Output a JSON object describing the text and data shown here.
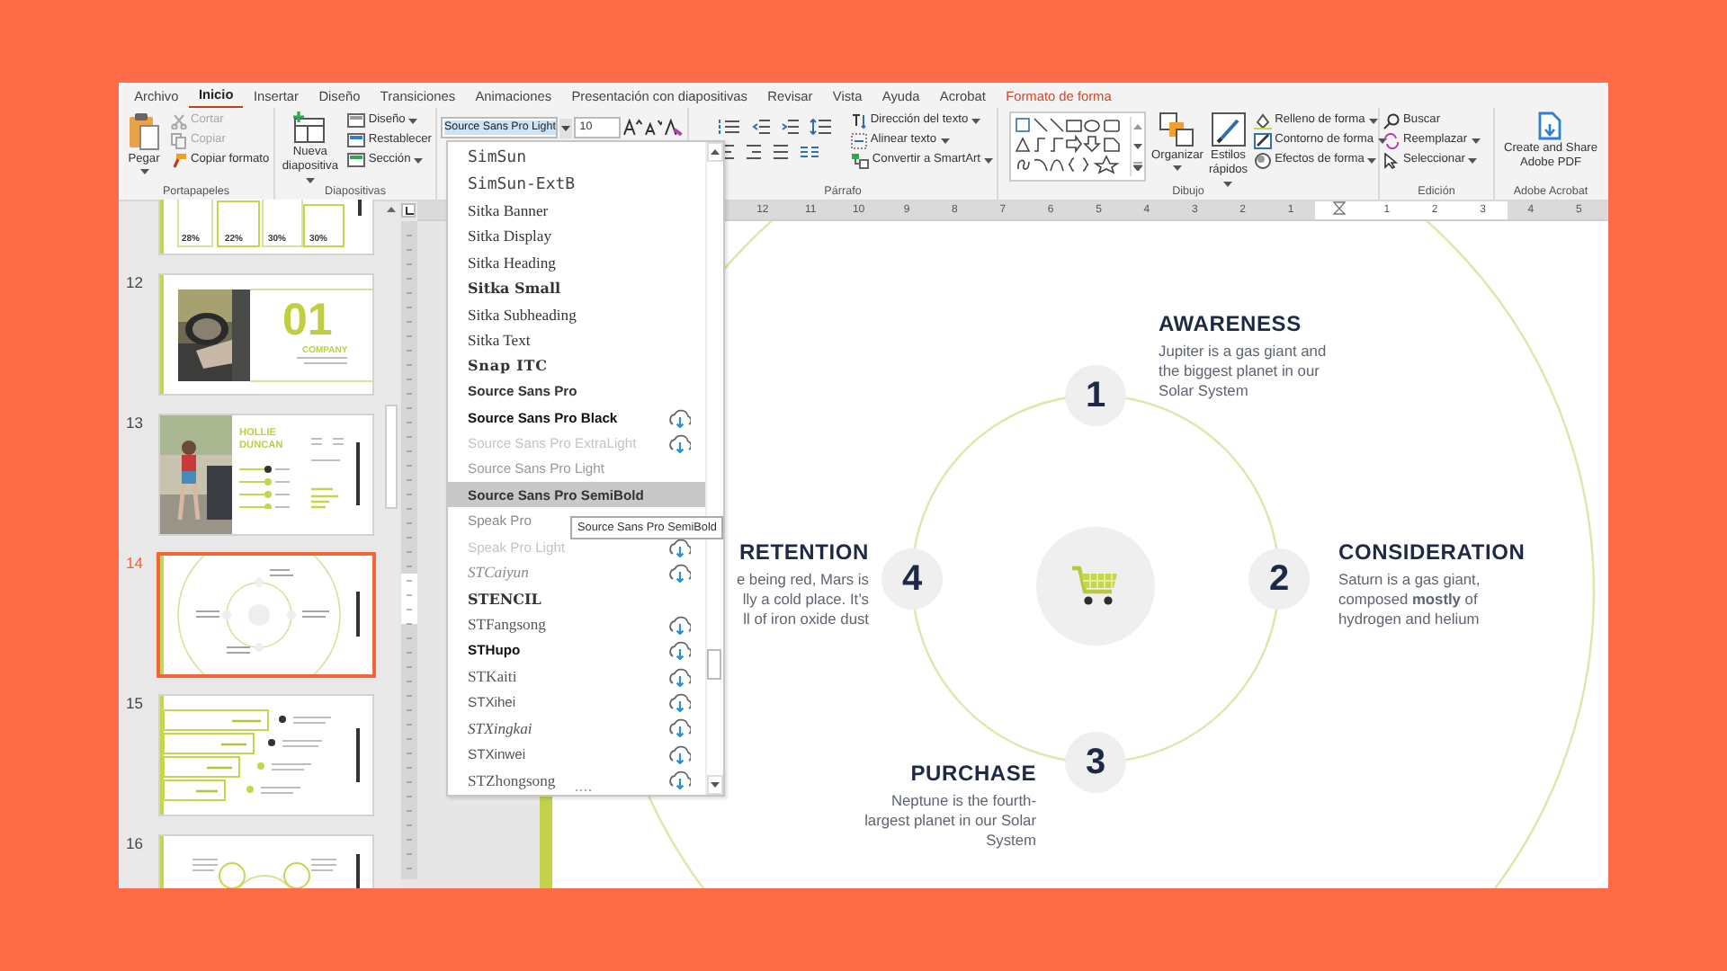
{
  "tabs": [
    {
      "label": "Archivo",
      "selected": false,
      "contextual": false
    },
    {
      "label": "Inicio",
      "selected": true,
      "contextual": false
    },
    {
      "label": "Insertar",
      "selected": false,
      "contextual": false
    },
    {
      "label": "Diseño",
      "selected": false,
      "contextual": false
    },
    {
      "label": "Transiciones",
      "selected": false,
      "contextual": false
    },
    {
      "label": "Animaciones",
      "selected": false,
      "contextual": false
    },
    {
      "label": "Presentación con diapositivas",
      "selected": false,
      "contextual": false
    },
    {
      "label": "Revisar",
      "selected": false,
      "contextual": false
    },
    {
      "label": "Vista",
      "selected": false,
      "contextual": false
    },
    {
      "label": "Ayuda",
      "selected": false,
      "contextual": false
    },
    {
      "label": "Acrobat",
      "selected": false,
      "contextual": false
    },
    {
      "label": "Formato de forma",
      "selected": false,
      "contextual": true
    }
  ],
  "ribbon": {
    "clipboard": {
      "title": "Portapapeles",
      "paste": "Pegar",
      "items": [
        {
          "label": "Cortar",
          "disabled": true
        },
        {
          "label": "Copiar",
          "disabled": true
        },
        {
          "label": "Copiar formato",
          "disabled": false
        }
      ]
    },
    "slides_group": {
      "title": "Diapositivas",
      "new_slide": "Nueva diapositiva",
      "items": [
        "Diseño",
        "Restablecer",
        "Sección"
      ]
    },
    "font": {
      "name": "Source Sans Pro Light",
      "size": "10"
    },
    "paragraph": {
      "title": "Párrafo",
      "items": [
        "Dirección del texto",
        "Alinear texto",
        "Convertir a SmartArt"
      ]
    },
    "drawing": {
      "title": "Dibujo",
      "arrange": "Organizar",
      "quick_styles": "Estilos rápidos",
      "items": [
        "Relleno de forma",
        "Contorno de forma",
        "Efectos de forma"
      ]
    },
    "editing": {
      "title": "Edición",
      "items": [
        "Buscar",
        "Reemplazar",
        "Seleccionar"
      ]
    },
    "acrobat": {
      "title": "Adobe Acrobat",
      "button": "Create and Share Adobe PDF"
    }
  },
  "font_list": {
    "items": [
      {
        "name": "SimSun",
        "cloud": false,
        "selected": false
      },
      {
        "name": "SimSun-ExtB",
        "cloud": false,
        "selected": false
      },
      {
        "name": "Sitka Banner",
        "cloud": false,
        "selected": false
      },
      {
        "name": "Sitka Display",
        "cloud": false,
        "selected": false
      },
      {
        "name": "Sitka Heading",
        "cloud": false,
        "selected": false
      },
      {
        "name": "Sitka Small",
        "cloud": false,
        "selected": false
      },
      {
        "name": "Sitka Subheading",
        "cloud": false,
        "selected": false
      },
      {
        "name": "Sitka Text",
        "cloud": false,
        "selected": false
      },
      {
        "name": "Snap ITC",
        "cloud": false,
        "selected": false
      },
      {
        "name": "Source Sans Pro",
        "cloud": false,
        "selected": false
      },
      {
        "name": "Source Sans Pro Black",
        "cloud": true,
        "selected": false
      },
      {
        "name": "Source Sans Pro ExtraLight",
        "cloud": true,
        "selected": false
      },
      {
        "name": "Source Sans Pro Light",
        "cloud": false,
        "selected": false
      },
      {
        "name": "Source Sans Pro SemiBold",
        "cloud": false,
        "selected": true
      },
      {
        "name": "Speak Pro",
        "cloud": false,
        "selected": false
      },
      {
        "name": "Speak Pro Light",
        "cloud": true,
        "selected": false
      },
      {
        "name": "STCaiyun",
        "cloud": true,
        "selected": false
      },
      {
        "name": "STENCIL",
        "cloud": false,
        "selected": false
      },
      {
        "name": "STFangsong",
        "cloud": true,
        "selected": false
      },
      {
        "name": "STHupo",
        "cloud": true,
        "selected": false
      },
      {
        "name": "STKaiti",
        "cloud": true,
        "selected": false
      },
      {
        "name": "STXihei",
        "cloud": true,
        "selected": false
      },
      {
        "name": "STXingkai",
        "cloud": true,
        "selected": false
      },
      {
        "name": "STXinwei",
        "cloud": true,
        "selected": false
      },
      {
        "name": "STZhongsong",
        "cloud": true,
        "selected": false
      }
    ],
    "tooltip": "Source Sans Pro SemiBold"
  },
  "thumbnails": [
    {
      "kind": "stats",
      "selected": false,
      "texts": [
        "28%",
        "22%",
        "30%",
        "30%"
      ]
    },
    {
      "number": "12",
      "kind": "cover",
      "selected": false,
      "texts": [
        "01",
        "COMPANY"
      ]
    },
    {
      "number": "13",
      "kind": "profile",
      "selected": false,
      "texts": [
        "HOLLIE",
        "DUNCAN"
      ]
    },
    {
      "number": "14",
      "kind": "cycle",
      "selected": true
    },
    {
      "number": "15",
      "kind": "steps",
      "selected": false
    },
    {
      "number": "16",
      "kind": "venn",
      "selected": false
    }
  ],
  "ruler": {
    "left_marks": [
      "12",
      "11",
      "10",
      "9",
      "8",
      "7",
      "6",
      "5",
      "4",
      "3",
      "2",
      "1"
    ],
    "right_marks": [
      "1",
      "2",
      "3",
      "4",
      "5"
    ]
  },
  "slide": {
    "stages": [
      {
        "number": "1",
        "title": "AWARENESS",
        "lines": [
          "Jupiter is a gas giant and",
          "the biggest planet in our",
          "Solar System"
        ]
      },
      {
        "number": "2",
        "title": "CONSIDERATION",
        "lines": [
          "Saturn is a gas giant,",
          "composed **mostly** of",
          "hydrogen and helium"
        ]
      },
      {
        "number": "3",
        "title": "PURCHASE",
        "lines": [
          "Neptune is the fourth-",
          "largest planet in our Solar",
          "System"
        ]
      },
      {
        "number": "4",
        "title": "RETENTION",
        "lines": [
          "e being red, Mars is",
          "lly a cold place. It’s",
          "ll of iron oxide dust"
        ]
      }
    ]
  }
}
